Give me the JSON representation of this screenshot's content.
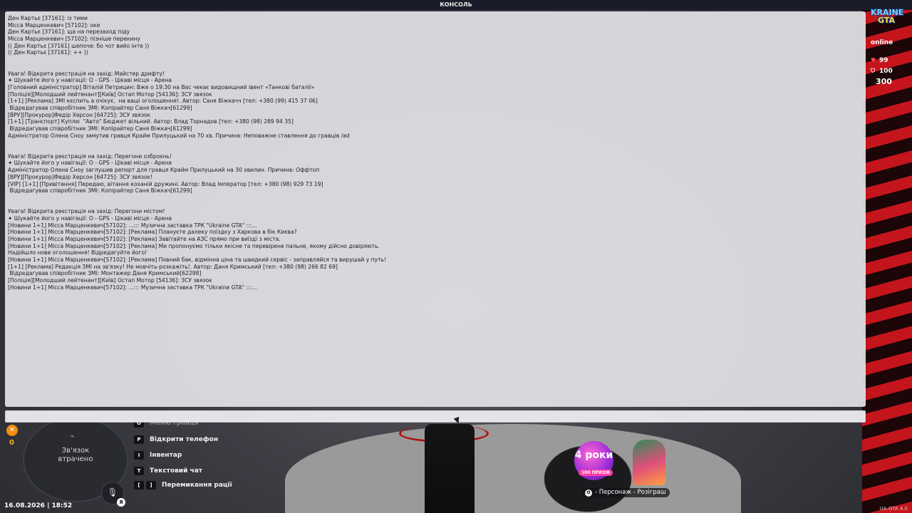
{
  "window": {
    "title": "КОНСОЛЬ"
  },
  "console": {
    "lines": [
      "Ден Картьє [37161]: із тими",
      "Місса Марценкевич [57102]: оке",
      "Ден Картьє [37161]: ща на перезаход піду",
      "Місса Марценкевич [57102]: пізніше перекину",
      "(( Ден Картьє [37161] шепоче: бо чот вийо інте ))",
      "(( Ден Картьє [37161]: ++ ))",
      "",
      "",
      "Увага! Відкрита реєстрація на захід: Майстер дрифту!",
      "✦ Шукайте його у навігації: O - GPS - Цікаві місця - Арена",
      "[Головний адміністратор] Віталій Петрицин: Вже о 19:30 на Вас чекає видовищний івент «Танкові баталії»",
      "[Поліція][Молодший лейтенант][Київ] Остап Мотор [54136]: ЗСУ звязок",
      "[1+1] [Реклама] ЗМІ кєспить а очікує,  на ваші оголошення!. Автор: Саня Віжкачч [тел: +380 (99) 415 37 06]",
      " Відредагував співробітник ЗМІ: Копірайтер Саня Віжкач[61299]",
      "[ВРУ][Прокурор]Федір Херсон [64725]: ЗСУ звязок",
      "[1+1] [Транспорт] Куплю  \"Авто\" Бюджет вільний. Автор: Влад Торнадов [тел: +380 (98) 289 94 35]",
      " Відредагував співробітник ЗМІ: Копірайтер Саня Віжкач[61299]",
      "Адміністратор Олена Сноу замутив гравця Крайм Прилуцький на 70 хв. Причина: Неповажне ставлення до гравців /ad",
      "",
      "",
      "Увага! Відкрита реєстрація на захід: Перегони озброєнь!",
      "✦ Шукайте його у навігації: O - GPS - Цікаві місця - Арена",
      "Адміністратор Олена Сноу заглушив репорт для гравця Крайм Прилуцький на 30 хвилин. Причина: Оффтоп",
      "[ВРУ][Прокурор]Федір Херсон [64725]: ЗСУ звязок!",
      "[VIP] [1+1] [Привітання] Передаю, вітання коханій дружині. Автор: Влад Імператор [тел: +380 (98) 929 73 19]",
      " Відредагував співробітник ЗМІ: Копірайтер Саня Віжкач[61299]",
      "",
      "",
      "Увага! Відкрита реєстрація на захід: Перегони містом!",
      "✦ Шукайте його у навігації: O - GPS - Цікаві місця - Арена",
      "[Новини 1+1] Місса Марценкевич[57102]: ...::: Музична заставка ТРК \"Ukraine GTA\" :::...",
      "[Новини 1+1] Місса Марценкевич[57102]: [Реклама] Плануєте далеку поїздку з Харкова в бік Києва?",
      "[Новини 1+1] Місса Марценкевич[57102]: [Реклама] Завітайте на АЗС прямо при виїзді з міста.",
      "[Новини 1+1] Місса Марценкевич[57102]: [Реклама] Ми пропонуємо тільки якісне та перевірене пальне, якому дійсно довіряють.",
      "Надійшло нове оголошення! Відредагуйте його!",
      "[Новини 1+1] Місса Марценкевич[57102]: [Реклама] Повний бак, відмінна ціна та швидкий сервіс - заправляйся та вирушай у путь!",
      "[1+1] [Реклама] Редакція ЗМІ на зв'язку! Не мовчіть-розкажіть!. Автор: Даня Кримський [тел: +380 (98) 266 82 69]",
      " Відредагував співробітник ЗМІ: Монтажер Даня Кримський[62298]",
      "[Поліція][Молодший лейтенант][Київ] Остап Мотор [54136]: ЗСУ звязок",
      "[Новини 1+1] Місса Марценкевич[57102]: ...::: Музична заставка ТРК \"Ukraine GTA\" :::..."
    ],
    "input_value": ""
  },
  "hud": {
    "logo_top": "KRAINE",
    "logo_bottom": "GTA",
    "online": "online",
    "health": "99",
    "armor": "100",
    "money": "300"
  },
  "minimap": {
    "status": "Зв'язок\nвтрачено",
    "mic_key": "Я"
  },
  "alerts": {
    "count": "0"
  },
  "datetime": "16.08.2026 | 18:52",
  "hints": [
    {
      "keys": [
        "О"
      ],
      "label": "Меню гравця",
      "faded": true
    },
    {
      "keys": [
        "P"
      ],
      "label": "Відкрити телефон"
    },
    {
      "keys": [
        "I"
      ],
      "label": "Інвентар"
    },
    {
      "keys": [
        "T"
      ],
      "label": "Текстовий чат"
    },
    {
      "keys": [
        "[",
        "]"
      ],
      "label": "Перемикання рації"
    }
  ],
  "promo": {
    "badge": "4 роки",
    "prizes": "100 ПРИЗІВ",
    "caption_key": "O",
    "caption": "- Персонаж - Розіграш"
  },
  "version": "UA-GTA 4.0",
  "colors": {
    "accent_red": "#c4141c",
    "console_bg": "#e2e2e6",
    "titlebar": "#1a1d29"
  }
}
